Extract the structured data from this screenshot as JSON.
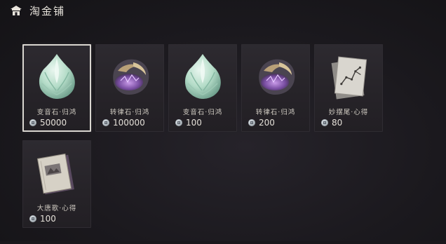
{
  "header": {
    "title": "淘金铺",
    "icon": "shop-house-icon"
  },
  "items": [
    {
      "name": "变音石·归鸿",
      "price": "50000",
      "icon": "jade-stone-icon",
      "selected": true
    },
    {
      "name": "转律石·归鸿",
      "price": "100000",
      "icon": "purple-ore-icon",
      "selected": false
    },
    {
      "name": "变音石·归鸿",
      "price": "100",
      "icon": "jade-stone-icon",
      "selected": false
    },
    {
      "name": "转律石·归鸿",
      "price": "200",
      "icon": "purple-ore-icon",
      "selected": false
    },
    {
      "name": "妙摆尾·心得",
      "price": "80",
      "icon": "skill-scroll-icon",
      "selected": false
    },
    {
      "name": "大唐歌·心得",
      "price": "100",
      "icon": "book-icon",
      "selected": false
    }
  ],
  "currency_icon": "silver-coin-icon",
  "colors": {
    "background": "#1b191e",
    "card": "#2a272c",
    "selected_border": "#d9d6d0",
    "text": "#e4e0d8"
  }
}
